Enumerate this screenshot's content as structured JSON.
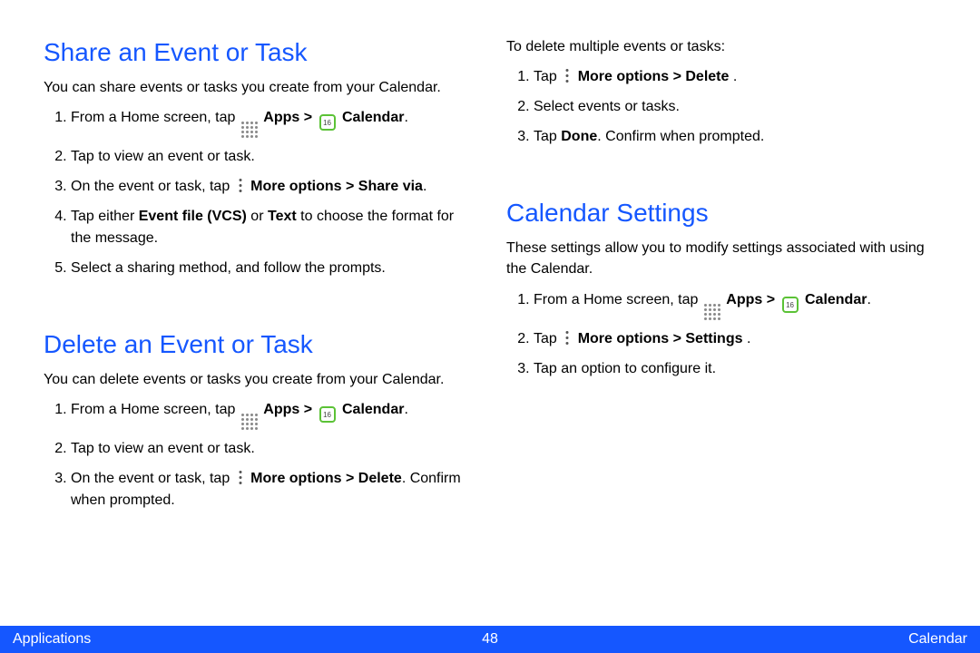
{
  "footer": {
    "left": "Applications",
    "center": "48",
    "right": "Calendar"
  },
  "left_col": {
    "section1": {
      "heading": "Share an Event or Task",
      "intro": "You can share events or tasks you create from your Calendar.",
      "items": {
        "i1_prefix": "From a Home screen, tap ",
        "i1_apps": "Apps > ",
        "i1_cal": "Calendar",
        "i1_suffix": ".",
        "i2": "Tap to view an event or task.",
        "i3_prefix": "On the event or task, tap ",
        "i3_bold": "More options > Share via",
        "i3_suffix": ".",
        "i4_a": "Tap either ",
        "i4_b1": "Event file (VCS)",
        "i4_mid": " or ",
        "i4_b2": "Text",
        "i4_c": " to choose the format for the message.",
        "i5": "Select a sharing method, and follow the prompts."
      }
    },
    "section2": {
      "heading": "Delete an Event or Task",
      "intro": "You can delete events or tasks you create from your Calendar.",
      "items": {
        "i1_prefix": "From a Home screen, tap ",
        "i1_apps": "Apps > ",
        "i1_cal": "Calendar",
        "i1_suffix": ".",
        "i2": "Tap to view an event or task.",
        "i3_prefix": "On the event or task, tap ",
        "i3_bold1": "More options > Delete",
        "i3_suffix": ". Confirm when prompted."
      }
    }
  },
  "right_col": {
    "lead": "To delete multiple events or tasks:",
    "top_items": {
      "i1_prefix": "Tap ",
      "i1_bold": "More options > Delete ",
      "i1_suffix": ".",
      "i2": "Select events or tasks.",
      "i3_a": "Tap ",
      "i3_bold": "Done",
      "i3_b": ". Confirm when prompted."
    },
    "section": {
      "heading": "Calendar Settings",
      "intro": "These settings allow you to modify settings associated with using the Calendar.",
      "items": {
        "i1_prefix": "From a Home screen, tap ",
        "i1_apps": "Apps > ",
        "i1_cal": "Calendar",
        "i1_suffix": ".",
        "i2_prefix": "Tap ",
        "i2_bold": "More options > Settings ",
        "i2_suffix": ".",
        "i3": "Tap an option to configure it."
      }
    }
  },
  "icons": {
    "calendar_day": "16"
  }
}
